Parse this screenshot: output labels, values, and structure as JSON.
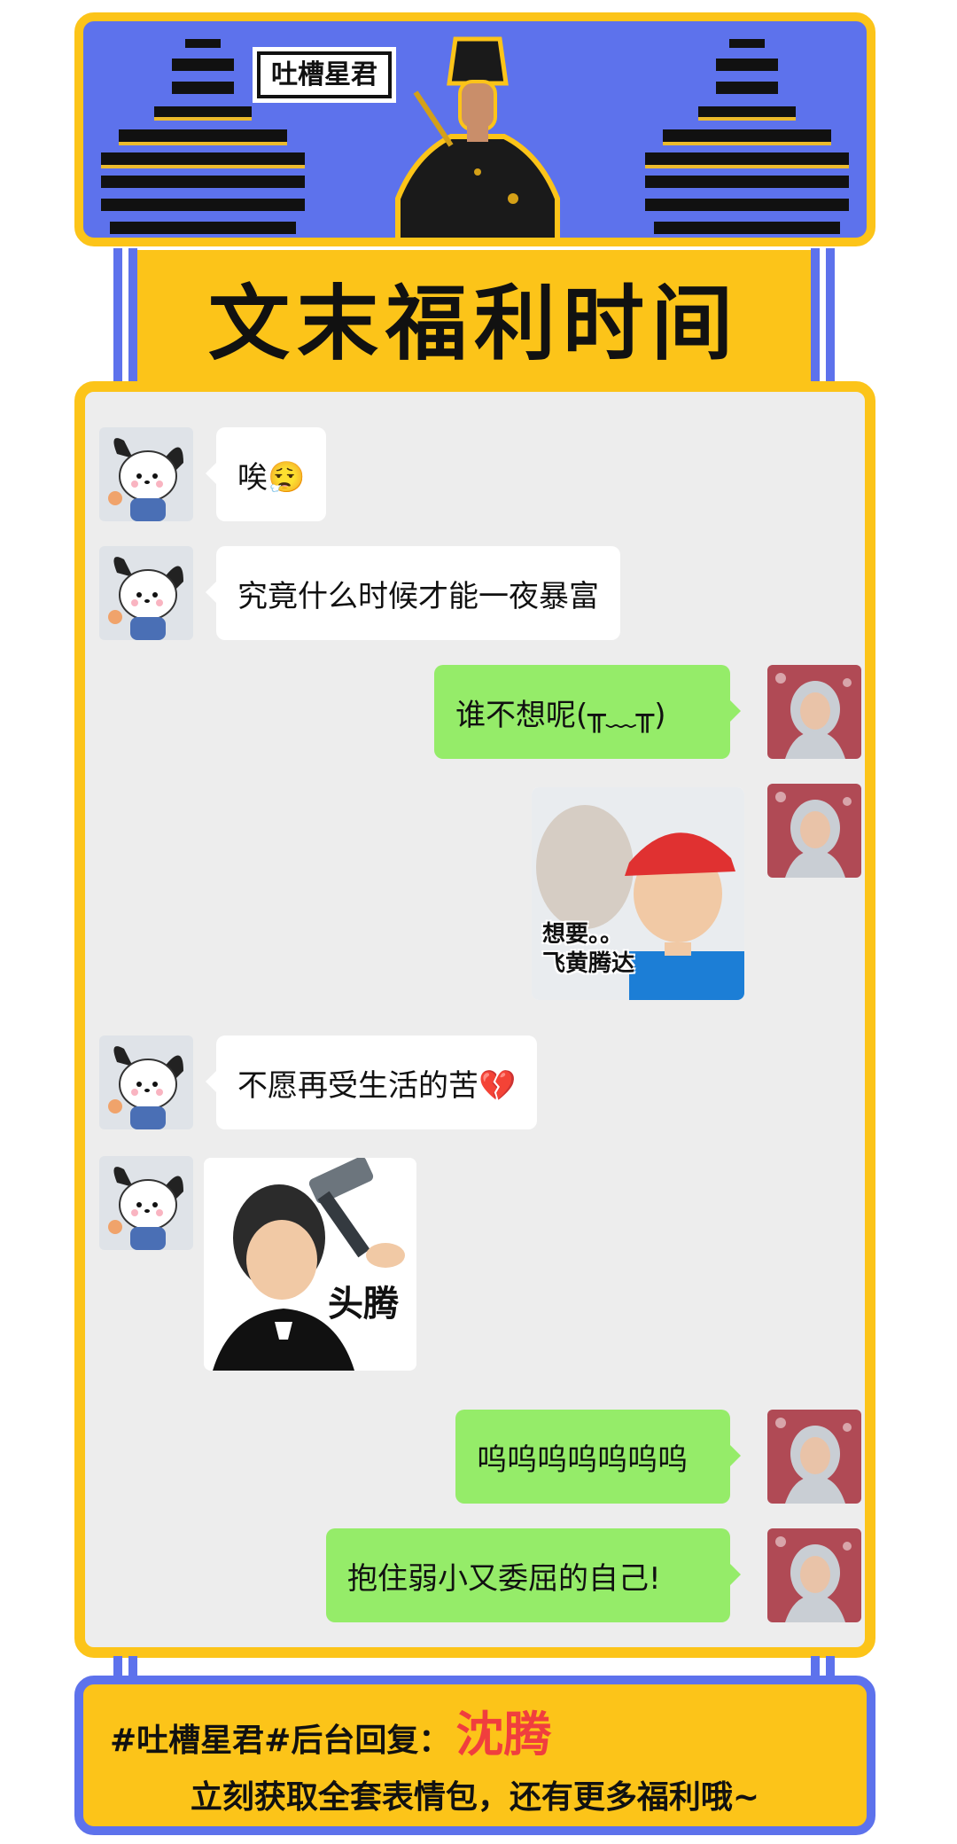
{
  "colors": {
    "brand_blue": "#5d72ec",
    "brand_yellow": "#fcc419",
    "chat_background": "#ededed",
    "incoming_bubble": "#ffffff",
    "outgoing_bubble": "#95ec69",
    "highlight_red": "#f03e3e"
  },
  "header": {
    "brand_tag": "吐槽星君",
    "title": "文末福利时间"
  },
  "chat": {
    "messages": [
      {
        "side": "left",
        "type": "text",
        "text": "唉😮‍💨",
        "avatar": "puppy-avatar"
      },
      {
        "side": "left",
        "type": "text",
        "text": "究竟什么时候才能一夜暴富",
        "avatar": "puppy-avatar"
      },
      {
        "side": "right",
        "type": "text",
        "text": "谁不想呢(╥﹏╥)",
        "avatar": "person-avatar"
      },
      {
        "side": "right",
        "type": "sticker",
        "caption": "想要。。\n飞黄腾达",
        "avatar": "person-avatar"
      },
      {
        "side": "left",
        "type": "text",
        "text": "不愿再受生活的苦💔",
        "avatar": "puppy-avatar"
      },
      {
        "side": "left",
        "type": "sticker",
        "caption": "头腾",
        "avatar": "puppy-avatar"
      },
      {
        "side": "right",
        "type": "text",
        "text": "呜呜呜呜呜呜呜",
        "avatar": "person-avatar"
      },
      {
        "side": "right",
        "type": "text",
        "text": "抱住弱小又委屈的自己!",
        "avatar": "person-avatar"
      }
    ]
  },
  "footer": {
    "prefix": "#吐槽星君#后台回复：",
    "keyword": "沈腾",
    "line2": "立刻获取全套表情包，还有更多福利哦~"
  }
}
